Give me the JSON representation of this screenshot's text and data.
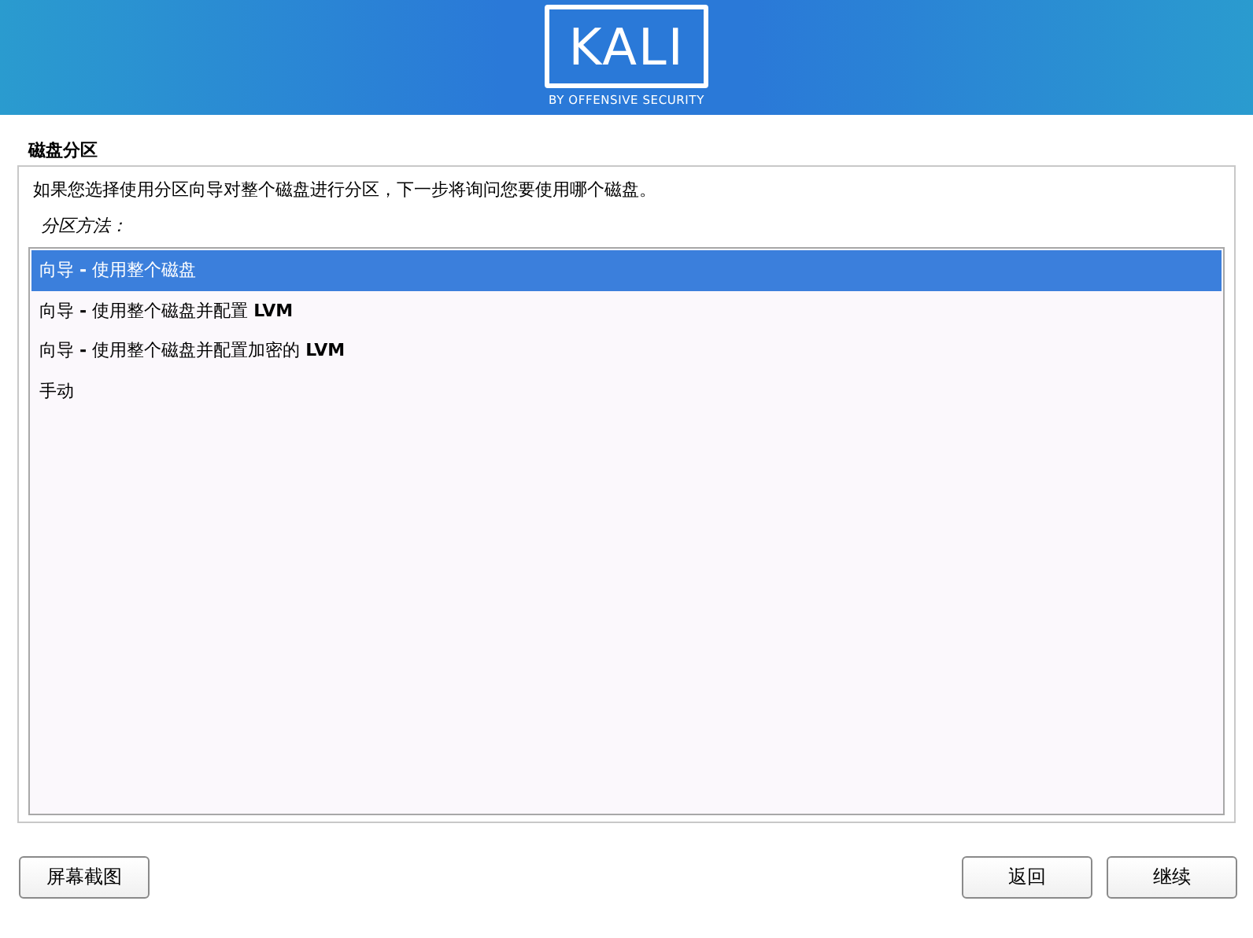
{
  "banner": {
    "logo": "KALI",
    "tagline": "BY OFFENSIVE SECURITY"
  },
  "title": "磁盘分区",
  "description": "如果您选择使用分区向导对整个磁盘进行分区，下一步将询问您要使用哪个磁盘。",
  "prompt": "分区方法：",
  "options": [
    {
      "label": "向导 **-** 使用整个磁盘",
      "selected": true
    },
    {
      "label": "向导 **-** 使用整个磁盘并配置 **LVM**",
      "selected": false
    },
    {
      "label": "向导 **-** 使用整个磁盘并配置加密的 **LVM**",
      "selected": false
    },
    {
      "label": "手动",
      "selected": false
    }
  ],
  "buttons": {
    "left": [
      "屏幕截图"
    ],
    "right": [
      "返回",
      "继续"
    ]
  }
}
